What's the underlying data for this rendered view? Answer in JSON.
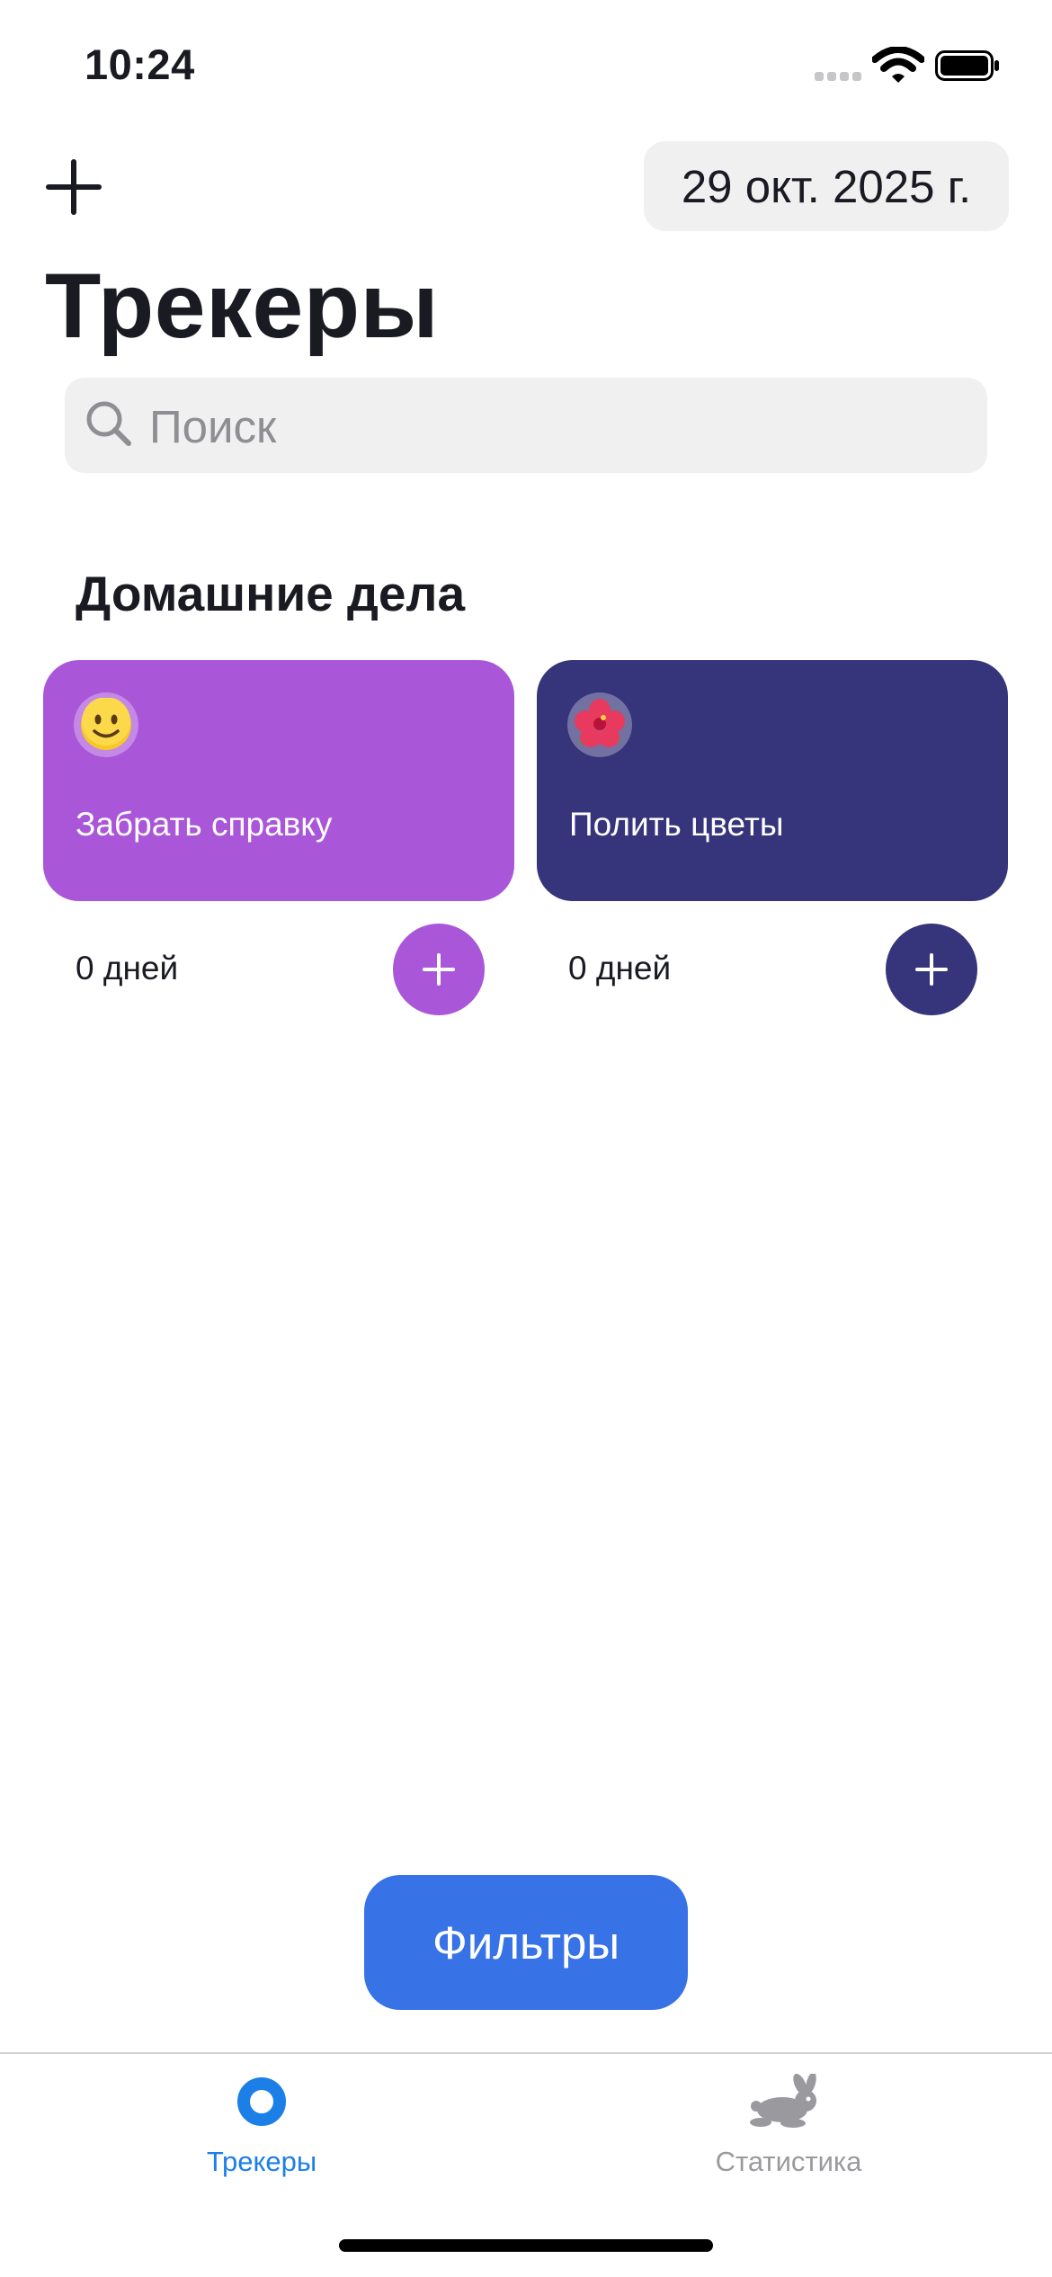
{
  "status_bar": {
    "time": "10:24"
  },
  "header": {
    "date": "29 окт. 2025 г.",
    "title": "Трекеры"
  },
  "search": {
    "placeholder": "Поиск",
    "value": ""
  },
  "section": {
    "title": "Домашние дела"
  },
  "trackers": [
    {
      "emoji": "🙂",
      "label": "Забрать справку",
      "days": "0 дней",
      "color": "#aa56d9"
    },
    {
      "emoji": "🌺",
      "label": "Полить цветы",
      "days": "0 дней",
      "color": "#36347a"
    }
  ],
  "filters_button": {
    "label": "Фильтры",
    "color": "#3772e7"
  },
  "tabbar": {
    "items": [
      {
        "label": "Трекеры",
        "icon": "trackers-icon",
        "active": true,
        "color": "#1c7fe8"
      },
      {
        "label": "Статистика",
        "icon": "rabbit-icon",
        "active": false,
        "color": "#9a9a9e"
      }
    ]
  }
}
